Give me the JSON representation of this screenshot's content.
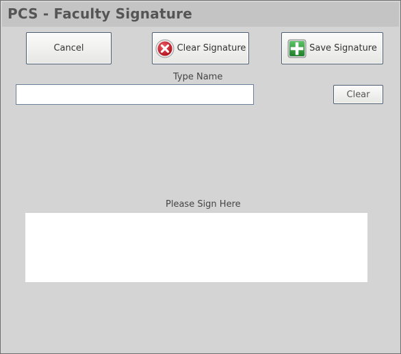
{
  "window": {
    "title": "PCS - Faculty Signature"
  },
  "toolbar": {
    "cancel_label": "Cancel",
    "clear_signature_label": "Clear Signature",
    "clear_signature_icon": "red-x-circle-icon",
    "save_signature_label": "Save Signature",
    "save_signature_icon": "green-plus-icon"
  },
  "name_section": {
    "label": "Type Name",
    "input_value": "",
    "clear_label": "Clear"
  },
  "signature_section": {
    "label": "Please Sign Here"
  },
  "colors": {
    "background": "#d4d4d4",
    "title_bar": "#c4c4c4",
    "title_text": "#555555",
    "clear_icon": "#d0222a",
    "save_icon": "#2f9a3a"
  }
}
